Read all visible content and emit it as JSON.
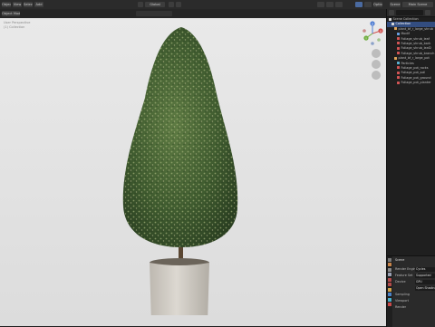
{
  "topbar": {
    "left_buttons": [
      "Object",
      "View",
      "Select",
      "Add"
    ],
    "center_label": "Global",
    "right_label": "Main Scene",
    "right_small": "Scene"
  },
  "viewport": {
    "mode_label": "Object Mode",
    "info_lines": [
      "User Perspective",
      "(1) Collection"
    ],
    "options_label": "Options",
    "gizmo_axes": [
      "X",
      "Y",
      "Z"
    ],
    "background_color": "#e2e2e2"
  },
  "outliner": {
    "title": "Scene Collection",
    "search_placeholder": "",
    "items": [
      {
        "label": "Scene Collection",
        "depth": 0,
        "icon": "collection-icon",
        "selected": false
      },
      {
        "label": "Collection",
        "depth": 1,
        "icon": "collection-icon",
        "selected": true
      },
      {
        "label": "plant_bf_r_large_shrub",
        "depth": 2,
        "icon": "object-icon",
        "selected": false
      },
      {
        "label": "Modif",
        "depth": 3,
        "icon": "modifier-icon",
        "selected": false
      },
      {
        "label": "Foliage_shrub_leaf",
        "depth": 3,
        "icon": "mesh-icon",
        "selected": false
      },
      {
        "label": "Foliage_shrub_bark",
        "depth": 3,
        "icon": "mesh-icon",
        "selected": false
      },
      {
        "label": "Foliage_shrub_leaf2",
        "depth": 3,
        "icon": "mesh-icon",
        "selected": false
      },
      {
        "label": "Foliage_shrub_branch",
        "depth": 3,
        "icon": "mesh-icon",
        "selected": false
      },
      {
        "label": "plant_bf_r_large_pot",
        "depth": 2,
        "icon": "object-icon",
        "selected": false
      },
      {
        "label": "Particles",
        "depth": 3,
        "icon": "particles-icon",
        "selected": false
      },
      {
        "label": "Foliage_pot_rocks",
        "depth": 3,
        "icon": "mesh-icon",
        "selected": false
      },
      {
        "label": "Foliage_pot_soil",
        "depth": 3,
        "icon": "mesh-icon",
        "selected": false
      },
      {
        "label": "Foliage_pot_ground",
        "depth": 3,
        "icon": "mesh-icon",
        "selected": false
      },
      {
        "label": "Foliage_pot_planter",
        "depth": 3,
        "icon": "mesh-icon",
        "selected": false
      }
    ]
  },
  "properties": {
    "header": "Scene",
    "rows": [
      {
        "label": "Render Engine",
        "value": "Cycles"
      },
      {
        "label": "Feature Set",
        "value": "Supported"
      },
      {
        "label": "Device",
        "value": "GPU"
      },
      {
        "label": "",
        "value": "Open Shading"
      },
      {
        "label": "Sampling",
        "value": ""
      },
      {
        "label": "Viewport",
        "value": ""
      },
      {
        "label": "Render",
        "value": ""
      }
    ]
  },
  "colors": {
    "accent": "#334d80",
    "panel": "#1f1f1f",
    "foliage_dark": "#2f4a25",
    "foliage_light": "#6f8a52",
    "pot": "#cfcac2"
  }
}
